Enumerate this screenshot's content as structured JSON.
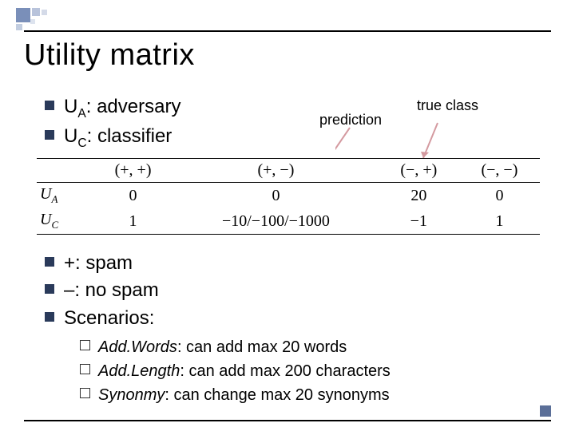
{
  "title": "Utility matrix",
  "defs": {
    "ua_sym": "U",
    "ua_sub": "A",
    "ua_text": ": adversary",
    "uc_sym": "U",
    "uc_sub": "C",
    "uc_text": ": classifier"
  },
  "labels": {
    "prediction": "prediction",
    "true_class": "true class"
  },
  "table": {
    "headers": [
      "(+, +)",
      "(+, −)",
      "(−, +)",
      "(−, −)"
    ],
    "rows": [
      {
        "label_sym": "U",
        "label_sub": "A",
        "cells": [
          "0",
          "0",
          "20",
          "0"
        ]
      },
      {
        "label_sym": "U",
        "label_sub": "C",
        "cells": [
          "1",
          "−10/−100/−1000",
          "−1",
          "1"
        ]
      }
    ]
  },
  "legend": {
    "plus": "+: spam",
    "minus": "–: no spam",
    "scenarios_label": "Scenarios:"
  },
  "scenarios": [
    {
      "name": "Add.Words",
      "desc": ": can add max 20 words"
    },
    {
      "name": "Add.Length",
      "desc": ": can add max 200 characters"
    },
    {
      "name": "Synonmy",
      "desc": ": can change max 20 synonyms"
    }
  ]
}
